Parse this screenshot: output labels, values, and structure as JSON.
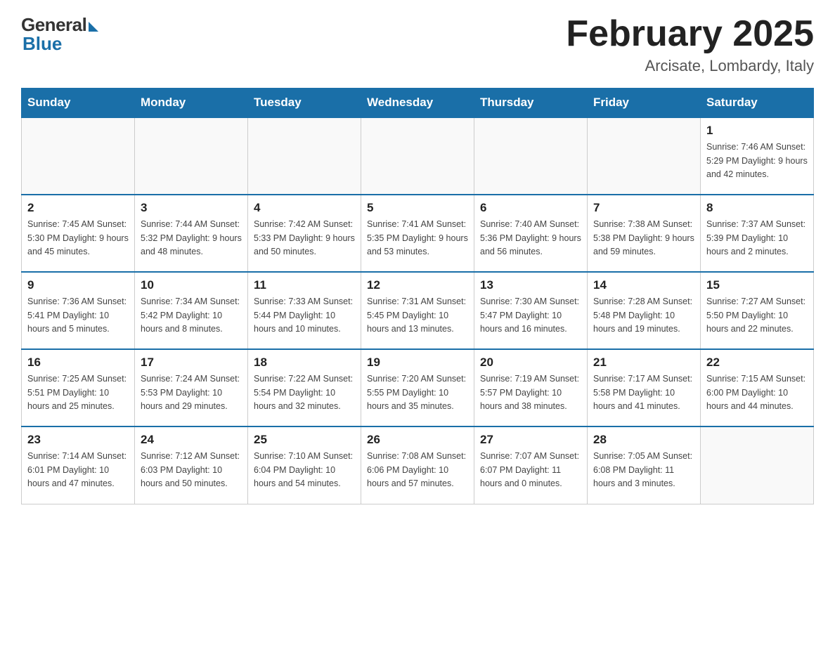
{
  "header": {
    "logo_general": "General",
    "logo_blue": "Blue",
    "month_title": "February 2025",
    "location": "Arcisate, Lombardy, Italy"
  },
  "weekdays": [
    "Sunday",
    "Monday",
    "Tuesday",
    "Wednesday",
    "Thursday",
    "Friday",
    "Saturday"
  ],
  "rows": [
    [
      {
        "day": "",
        "info": ""
      },
      {
        "day": "",
        "info": ""
      },
      {
        "day": "",
        "info": ""
      },
      {
        "day": "",
        "info": ""
      },
      {
        "day": "",
        "info": ""
      },
      {
        "day": "",
        "info": ""
      },
      {
        "day": "1",
        "info": "Sunrise: 7:46 AM\nSunset: 5:29 PM\nDaylight: 9 hours\nand 42 minutes."
      }
    ],
    [
      {
        "day": "2",
        "info": "Sunrise: 7:45 AM\nSunset: 5:30 PM\nDaylight: 9 hours\nand 45 minutes."
      },
      {
        "day": "3",
        "info": "Sunrise: 7:44 AM\nSunset: 5:32 PM\nDaylight: 9 hours\nand 48 minutes."
      },
      {
        "day": "4",
        "info": "Sunrise: 7:42 AM\nSunset: 5:33 PM\nDaylight: 9 hours\nand 50 minutes."
      },
      {
        "day": "5",
        "info": "Sunrise: 7:41 AM\nSunset: 5:35 PM\nDaylight: 9 hours\nand 53 minutes."
      },
      {
        "day": "6",
        "info": "Sunrise: 7:40 AM\nSunset: 5:36 PM\nDaylight: 9 hours\nand 56 minutes."
      },
      {
        "day": "7",
        "info": "Sunrise: 7:38 AM\nSunset: 5:38 PM\nDaylight: 9 hours\nand 59 minutes."
      },
      {
        "day": "8",
        "info": "Sunrise: 7:37 AM\nSunset: 5:39 PM\nDaylight: 10 hours\nand 2 minutes."
      }
    ],
    [
      {
        "day": "9",
        "info": "Sunrise: 7:36 AM\nSunset: 5:41 PM\nDaylight: 10 hours\nand 5 minutes."
      },
      {
        "day": "10",
        "info": "Sunrise: 7:34 AM\nSunset: 5:42 PM\nDaylight: 10 hours\nand 8 minutes."
      },
      {
        "day": "11",
        "info": "Sunrise: 7:33 AM\nSunset: 5:44 PM\nDaylight: 10 hours\nand 10 minutes."
      },
      {
        "day": "12",
        "info": "Sunrise: 7:31 AM\nSunset: 5:45 PM\nDaylight: 10 hours\nand 13 minutes."
      },
      {
        "day": "13",
        "info": "Sunrise: 7:30 AM\nSunset: 5:47 PM\nDaylight: 10 hours\nand 16 minutes."
      },
      {
        "day": "14",
        "info": "Sunrise: 7:28 AM\nSunset: 5:48 PM\nDaylight: 10 hours\nand 19 minutes."
      },
      {
        "day": "15",
        "info": "Sunrise: 7:27 AM\nSunset: 5:50 PM\nDaylight: 10 hours\nand 22 minutes."
      }
    ],
    [
      {
        "day": "16",
        "info": "Sunrise: 7:25 AM\nSunset: 5:51 PM\nDaylight: 10 hours\nand 25 minutes."
      },
      {
        "day": "17",
        "info": "Sunrise: 7:24 AM\nSunset: 5:53 PM\nDaylight: 10 hours\nand 29 minutes."
      },
      {
        "day": "18",
        "info": "Sunrise: 7:22 AM\nSunset: 5:54 PM\nDaylight: 10 hours\nand 32 minutes."
      },
      {
        "day": "19",
        "info": "Sunrise: 7:20 AM\nSunset: 5:55 PM\nDaylight: 10 hours\nand 35 minutes."
      },
      {
        "day": "20",
        "info": "Sunrise: 7:19 AM\nSunset: 5:57 PM\nDaylight: 10 hours\nand 38 minutes."
      },
      {
        "day": "21",
        "info": "Sunrise: 7:17 AM\nSunset: 5:58 PM\nDaylight: 10 hours\nand 41 minutes."
      },
      {
        "day": "22",
        "info": "Sunrise: 7:15 AM\nSunset: 6:00 PM\nDaylight: 10 hours\nand 44 minutes."
      }
    ],
    [
      {
        "day": "23",
        "info": "Sunrise: 7:14 AM\nSunset: 6:01 PM\nDaylight: 10 hours\nand 47 minutes."
      },
      {
        "day": "24",
        "info": "Sunrise: 7:12 AM\nSunset: 6:03 PM\nDaylight: 10 hours\nand 50 minutes."
      },
      {
        "day": "25",
        "info": "Sunrise: 7:10 AM\nSunset: 6:04 PM\nDaylight: 10 hours\nand 54 minutes."
      },
      {
        "day": "26",
        "info": "Sunrise: 7:08 AM\nSunset: 6:06 PM\nDaylight: 10 hours\nand 57 minutes."
      },
      {
        "day": "27",
        "info": "Sunrise: 7:07 AM\nSunset: 6:07 PM\nDaylight: 11 hours\nand 0 minutes."
      },
      {
        "day": "28",
        "info": "Sunrise: 7:05 AM\nSunset: 6:08 PM\nDaylight: 11 hours\nand 3 minutes."
      },
      {
        "day": "",
        "info": ""
      }
    ]
  ]
}
